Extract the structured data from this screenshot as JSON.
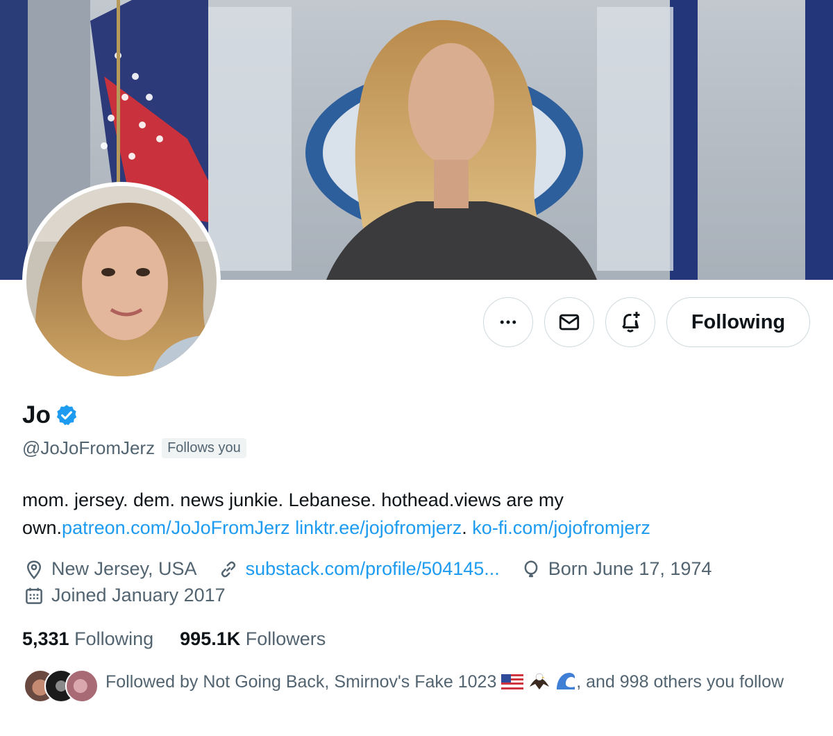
{
  "profile": {
    "display_name": "Jo",
    "handle": "@JoJoFromJerz",
    "follows_you": "Follows you",
    "bio_text": "mom. jersey. dem. news junkie. Lebanese. hothead.views are my own.",
    "bio_links": [
      "patreon.com/JoJoFromJerz",
      "linktr.ee/jojofromjerz",
      "ko-fi.com/jojofromjerz"
    ],
    "bio_separator": ". ",
    "location": "New Jersey, USA",
    "website": "substack.com/profile/504145...",
    "birthday": "Born June 17, 1974",
    "joined": "Joined January 2017"
  },
  "stats": {
    "following_count": "5,331",
    "following_label": "Following",
    "followers_count": "995.1K",
    "followers_label": "Followers"
  },
  "followed_by": {
    "prefix": "Followed by Not Going Back, Smirnov's Fake 1023",
    "suffix": ", and 998 others you follow"
  },
  "actions": {
    "following_button": "Following"
  },
  "icons": {
    "more": "more-icon",
    "message": "envelope-icon",
    "notify": "bell-plus-icon",
    "location": "location-pin-icon",
    "link": "link-icon",
    "birthday": "balloon-icon",
    "joined": "calendar-icon",
    "verified": "verified-badge-icon"
  },
  "colors": {
    "link": "#1d9bf0",
    "secondary_text": "#536471",
    "primary_text": "#0f1419",
    "verified": "#1d9bf0"
  }
}
